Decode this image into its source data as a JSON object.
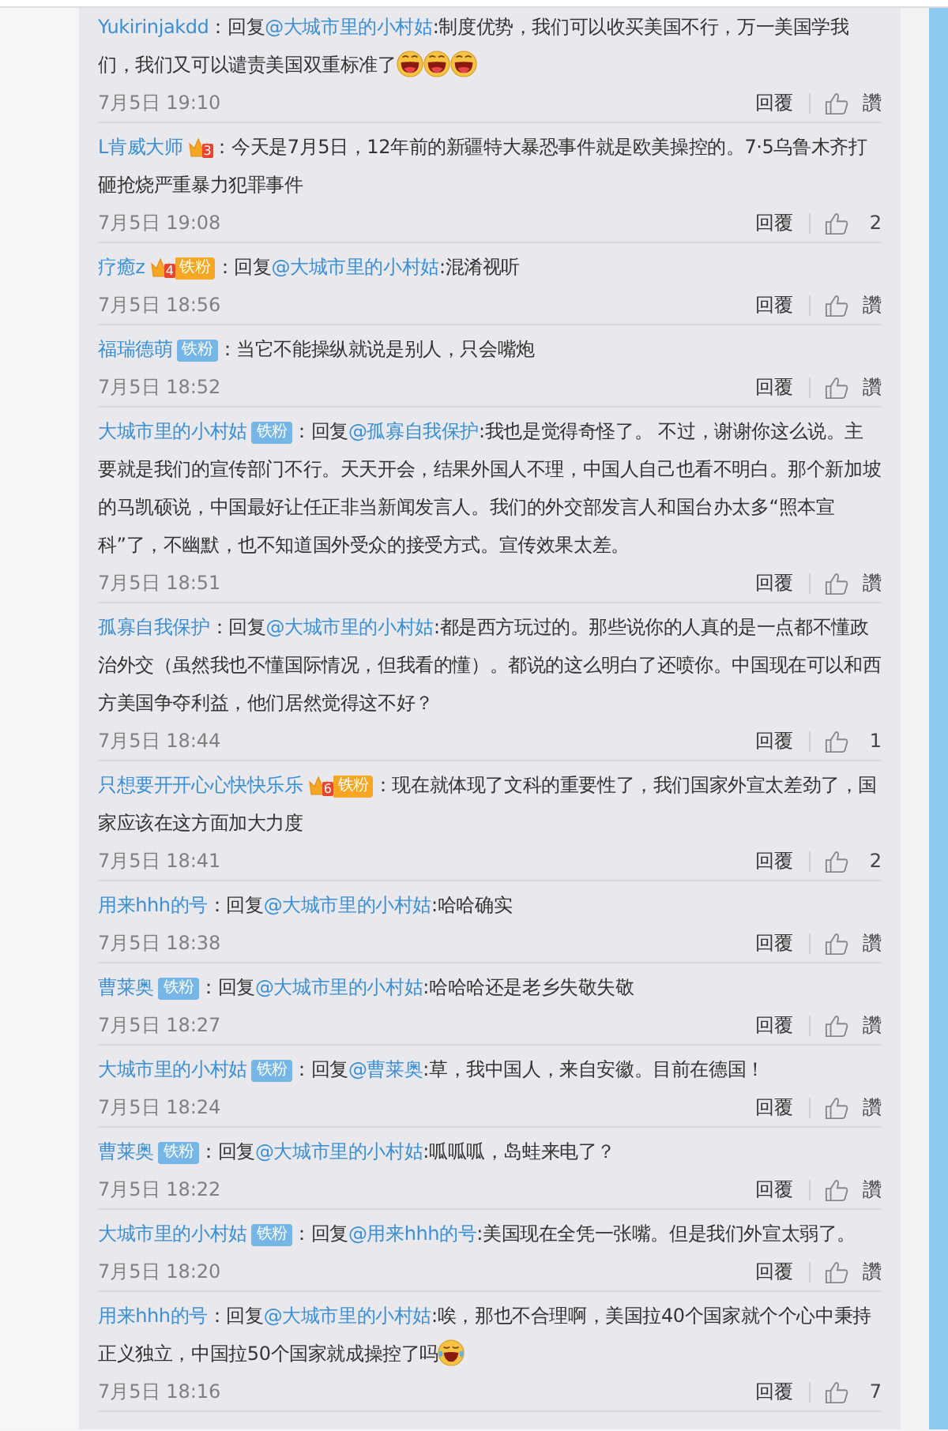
{
  "comments": [
    {
      "name": "Yukirinjakdd",
      "separator": "：",
      "reply": {
        "label": "回复",
        "mention": "@大城市里的小村姑"
      },
      "text": ":制度优势，我们可以收买美国不行，万一美国学我们，我们又可以谴责美国双重标准了",
      "emojis": [
        {
          "kind": "grin"
        },
        {
          "kind": "grin"
        },
        {
          "kind": "grin"
        }
      ],
      "time": "7月5日 19:10",
      "reply_label": "回覆",
      "like_label": "讚"
    },
    {
      "name": "L肯威大师",
      "separator": "：",
      "badges": [
        {
          "kind": "crown",
          "rank": "3"
        }
      ],
      "text": "今天是7月5日，12年前的新疆特大暴恐事件就是欧美操控的。7·5乌鲁木齐打砸抢烧严重暴力犯罪事件",
      "time": "7月5日 19:08",
      "reply_label": "回覆",
      "like_label": "2"
    },
    {
      "name": "疗癒z",
      "separator": "：",
      "badges": [
        {
          "kind": "crown",
          "rank": "4"
        },
        {
          "kind": "fan-gold",
          "label": "铁粉"
        }
      ],
      "reply": {
        "label": "回复",
        "mention": "@大城市里的小村姑"
      },
      "text": ":混淆视听",
      "time": "7月5日 18:56",
      "reply_label": "回覆",
      "like_label": "讚"
    },
    {
      "name": "福瑞德萌",
      "separator": "：",
      "badges": [
        {
          "kind": "fan",
          "label": "铁粉"
        }
      ],
      "text": "当它不能操纵就说是别人，只会嘴炮",
      "time": "7月5日 18:52",
      "reply_label": "回覆",
      "like_label": "讚"
    },
    {
      "name": "大城市里的小村姑",
      "separator": "：",
      "badges": [
        {
          "kind": "fan",
          "label": "铁粉"
        }
      ],
      "reply": {
        "label": "回复",
        "mention": "@孤寡自我保护"
      },
      "text": ":我也是觉得奇怪了。 不过，谢谢你这么说。主要就是我们的宣传部门不行。天天开会，结果外国人不理，中国人自己也看不明白。那个新加坡的马凯硕说，中国最好让任正非当新闻发言人。我们的外交部发言人和国台办太多“照本宣科”了，不幽默，也不知道国外受众的接受方式。宣传效果太差。",
      "time": "7月5日 18:51",
      "reply_label": "回覆",
      "like_label": "讚"
    },
    {
      "name": "孤寡自我保护",
      "separator": "：",
      "reply": {
        "label": "回复",
        "mention": "@大城市里的小村姑"
      },
      "text": ":都是西方玩过的。那些说你的人真的是一点都不懂政治外交（虽然我也不懂国际情况，但我看的懂）。都说的这么明白了还喷你。中国现在可以和西方美国争夺利益，他们居然觉得这不好？",
      "time": "7月5日 18:44",
      "reply_label": "回覆",
      "like_label": "1"
    },
    {
      "name": "只想要开开心心快快乐乐",
      "separator": "：",
      "badges": [
        {
          "kind": "crown",
          "rank": "6"
        },
        {
          "kind": "fan-gold",
          "label": "铁粉"
        }
      ],
      "text": "现在就体现了文科的重要性了，我们国家外宣太差劲了，国家应该在这方面加大力度",
      "time": "7月5日 18:41",
      "reply_label": "回覆",
      "like_label": "2"
    },
    {
      "name": "用来hhh的号",
      "separator": "：",
      "reply": {
        "label": "回复",
        "mention": "@大城市里的小村姑"
      },
      "text": ":哈哈确实",
      "time": "7月5日 18:38",
      "reply_label": "回覆",
      "like_label": "讚"
    },
    {
      "name": "曹莱奥",
      "separator": "：",
      "badges": [
        {
          "kind": "fan",
          "label": "铁粉"
        }
      ],
      "reply": {
        "label": "回复",
        "mention": "@大城市里的小村姑"
      },
      "text": ":哈哈哈还是老乡失敬失敬",
      "time": "7月5日 18:27",
      "reply_label": "回覆",
      "like_label": "讚"
    },
    {
      "name": "大城市里的小村姑",
      "separator": "：",
      "badges": [
        {
          "kind": "fan",
          "label": "铁粉"
        }
      ],
      "reply": {
        "label": "回复",
        "mention": "@曹莱奥"
      },
      "text": ":草，我中国人，来自安徽。目前在德国！",
      "time": "7月5日 18:24",
      "reply_label": "回覆",
      "like_label": "讚"
    },
    {
      "name": "曹莱奥",
      "separator": "：",
      "badges": [
        {
          "kind": "fan",
          "label": "铁粉"
        }
      ],
      "reply": {
        "label": "回复",
        "mention": "@大城市里的小村姑"
      },
      "text": ":呱呱呱，岛蛙来电了？",
      "time": "7月5日 18:22",
      "reply_label": "回覆",
      "like_label": "讚"
    },
    {
      "name": "大城市里的小村姑",
      "separator": "：",
      "badges": [
        {
          "kind": "fan",
          "label": "铁粉"
        }
      ],
      "reply": {
        "label": "回复",
        "mention": "@用来hhh的号"
      },
      "text": ":美国现在全凭一张嘴。但是我们外宣太弱了。",
      "time": "7月5日 18:20",
      "reply_label": "回覆",
      "like_label": "讚"
    },
    {
      "name": "用来hhh的号",
      "separator": "：",
      "reply": {
        "label": "回复",
        "mention": "@大城市里的小村姑"
      },
      "text": ":唉，那也不合理啊，美国拉40个国家就个个心中秉持正义独立，中国拉50个国家就成操控了吗",
      "emojis": [
        {
          "kind": "tears"
        }
      ],
      "time": "7月5日 18:16",
      "reply_label": "回覆",
      "like_label": "7"
    }
  ]
}
